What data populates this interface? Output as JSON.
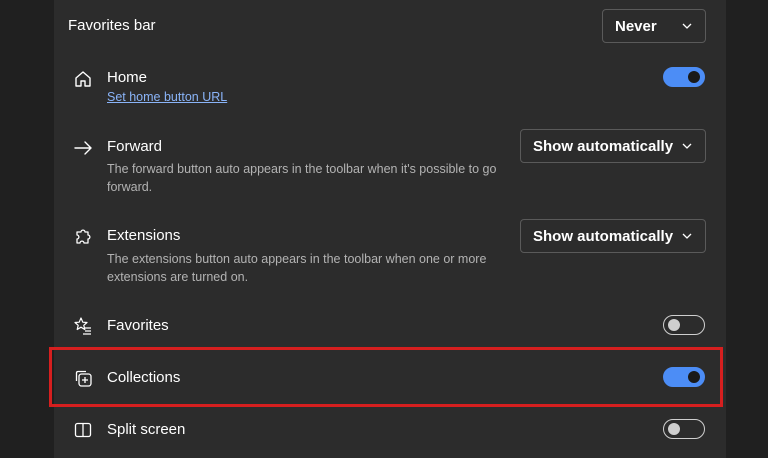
{
  "favorites_bar": {
    "label": "Favorites bar",
    "selected": "Never"
  },
  "home": {
    "label": "Home",
    "link": "Set home button URL",
    "toggle": "on"
  },
  "forward": {
    "label": "Forward",
    "description": "The forward button auto appears in the toolbar when it's possible to go forward.",
    "selected": "Show automatically"
  },
  "extensions": {
    "label": "Extensions",
    "description": "The extensions button auto appears in the toolbar when one or more extensions are turned on.",
    "selected": "Show automatically"
  },
  "favorites": {
    "label": "Favorites",
    "toggle": "off"
  },
  "collections": {
    "label": "Collections",
    "toggle": "on"
  },
  "split_screen": {
    "label": "Split screen",
    "toggle": "off"
  },
  "colors": {
    "accent": "#4c8df6",
    "highlight": "#d61f1f",
    "background": "#2c2c2c"
  },
  "icons": {
    "home": "home-icon",
    "forward": "arrow-right-icon",
    "extensions": "puzzle-icon",
    "favorites": "star-list-icon",
    "collections": "collections-icon",
    "split_screen": "split-screen-icon"
  }
}
